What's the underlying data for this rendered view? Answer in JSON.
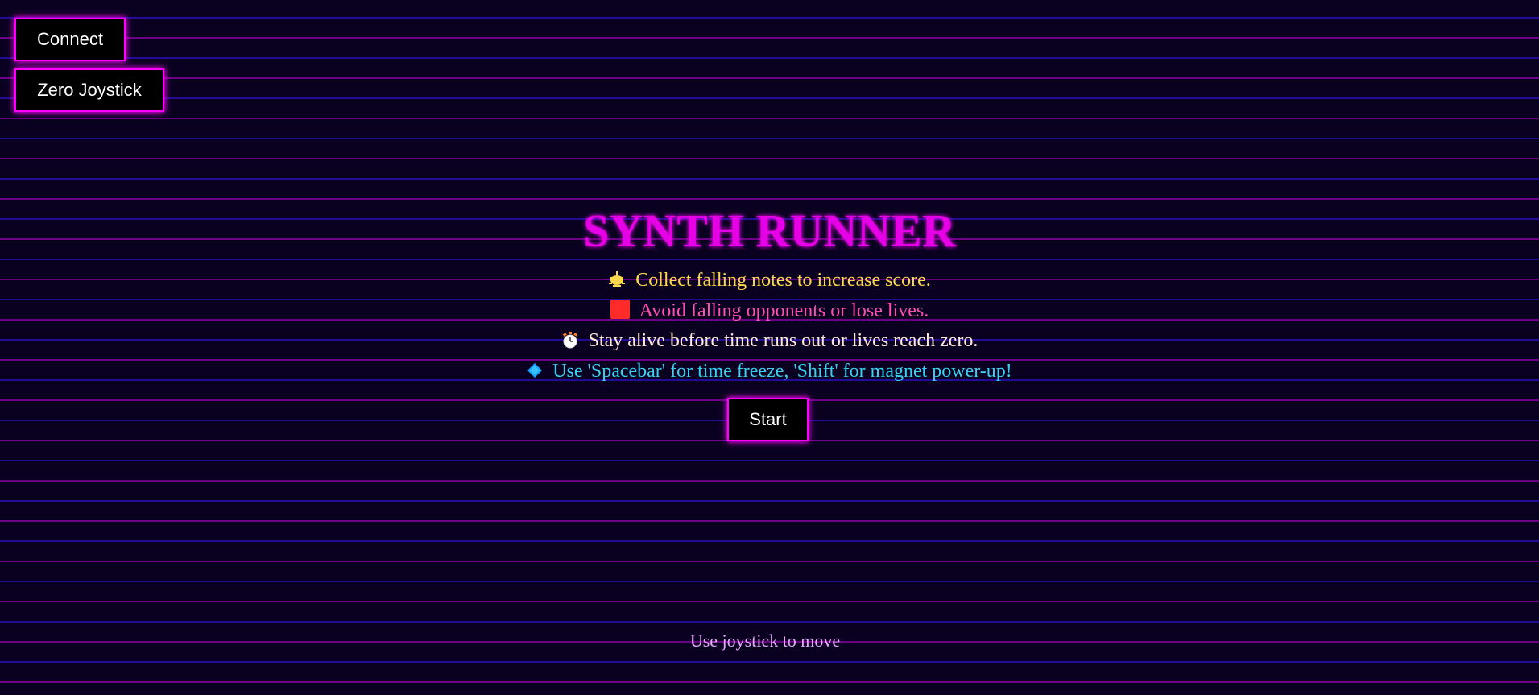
{
  "controls": {
    "connect_label": "Connect",
    "zero_joystick_label": "Zero Joystick",
    "start_label": "Start"
  },
  "game": {
    "title": "SYNTH RUNNER",
    "rules": [
      {
        "icon": "music-note-icon",
        "text": "Collect falling notes to increase score."
      },
      {
        "icon": "red-square-icon",
        "text": "Avoid falling opponents or lose lives."
      },
      {
        "icon": "stopwatch-icon",
        "text": "Stay alive before time runs out or lives reach zero."
      },
      {
        "icon": "blue-diamond-icon",
        "text": "Use 'Spacebar' for time freeze, 'Shift' for magnet power-up!"
      }
    ],
    "footer_hint": "Use joystick to move"
  },
  "colors": {
    "background": "#0a0020",
    "neon_magenta": "#ff00ff",
    "title": "#e600e6",
    "rule_notes": "#ffd84d",
    "rule_opponents": "#ff4fb0",
    "rule_time": "#ffe9d6",
    "rule_powerups": "#3ad0f0",
    "grid_line_blue": "#3a1cff",
    "grid_line_magenta": "#c000e0"
  }
}
